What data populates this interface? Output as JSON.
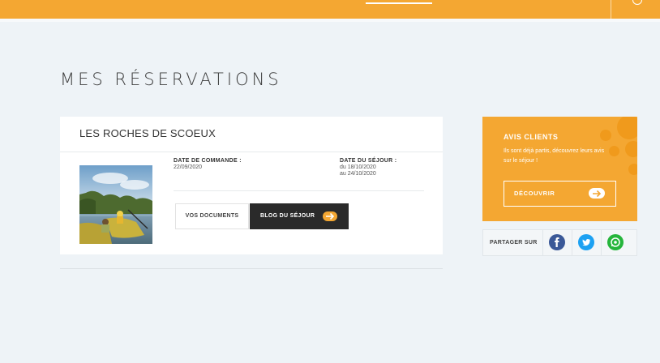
{
  "header": {
    "colors": {
      "primary": "#f4a732"
    },
    "user_icon": "user-icon"
  },
  "page": {
    "title": "MES RÉSERVATIONS"
  },
  "reservation": {
    "title": "LES ROCHES DE SCOEUX",
    "order_date_label": "DATE DE COMMANDE :",
    "order_date": "22/09/2020",
    "stay_label": "DATE DU SÉJOUR :",
    "stay_from": "du 18/10/2020",
    "stay_to": "au 24/10/2020",
    "documents_button": "VOS DOCUMENTS",
    "blog_button": "BLOG DU SÉJOUR",
    "photo": "kayak-lake-photo"
  },
  "avis": {
    "title": "AVIS CLIENTS",
    "text": "Ils sont déjà partis, découvrez leurs avis sur le séjour !",
    "button": "DÉCOUVRIR"
  },
  "share": {
    "label": "PARTAGER SUR",
    "networks": [
      {
        "name": "facebook",
        "icon": "facebook-icon",
        "color": "#3b5998"
      },
      {
        "name": "twitter",
        "icon": "twitter-icon",
        "color": "#1da1f2"
      },
      {
        "name": "whatsapp",
        "icon": "whatsapp-icon",
        "color": "#25b53b"
      }
    ]
  }
}
